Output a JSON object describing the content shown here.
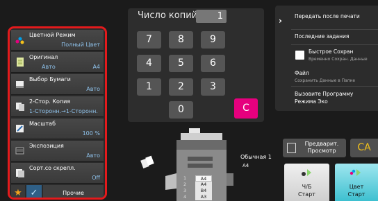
{
  "copies": {
    "label": "Число копий",
    "value": "1"
  },
  "keypad": {
    "keys": [
      "7",
      "8",
      "9",
      "4",
      "5",
      "6",
      "1",
      "2",
      "3",
      "0"
    ],
    "clear": "C"
  },
  "settings": [
    {
      "name": "Цветной Режим",
      "value": "Полный Цвет",
      "icon": "color-dots-icon"
    },
    {
      "name": "Оригинал",
      "value": "Авто",
      "value2": "A4",
      "icon": "document-icon"
    },
    {
      "name": "Выбор Бумаги",
      "value": "Авто",
      "icon": "paper-tray-icon"
    },
    {
      "name": "2-Стор. Копия",
      "value": "1-Сторонн.→1-Сторонн.",
      "icon": "duplex-icon"
    },
    {
      "name": "Масштаб",
      "value": "100 %",
      "icon": "scale-icon"
    },
    {
      "name": "Экспозиция",
      "value": "Авто",
      "icon": "exposure-icon"
    },
    {
      "name": "Сорт.со скрепл.",
      "value": "Off",
      "icon": "staple-sort-icon"
    }
  ],
  "left_bottom": {
    "other": "Прочие"
  },
  "side_menu": {
    "send_after_print": "Передать после печати",
    "recent_jobs": "Последние задания",
    "quick_save": "Быстрое Сохран",
    "quick_save_sub": "Временно Сохран. Данные",
    "file": "Файл",
    "file_sub": "Сохранить Данные в Папке",
    "eco": "Вызовите Программу Режима Эко"
  },
  "preview": {
    "line1": "Предварит.",
    "line2": "Просмотр"
  },
  "ca": "CA",
  "start_bw": {
    "line1": "Ч/Б",
    "line2": "Старт"
  },
  "start_color": {
    "line1": "Цвет",
    "line2": "Старт"
  },
  "printer": {
    "tray_label": "Обычная 1",
    "tray_size": "A4",
    "trays": [
      {
        "num": "1",
        "size": "A4"
      },
      {
        "num": "2",
        "size": "A4"
      },
      {
        "num": "3",
        "size": "B4"
      },
      {
        "num": "4",
        "size": "A3"
      }
    ]
  },
  "colors": {
    "highlight_border": "#e31a1c",
    "value_text": "#8ec1ea",
    "clear_key": "#e6007e",
    "ca_text": "#f3c21b",
    "start_color_bg": "#3ec0d0"
  }
}
